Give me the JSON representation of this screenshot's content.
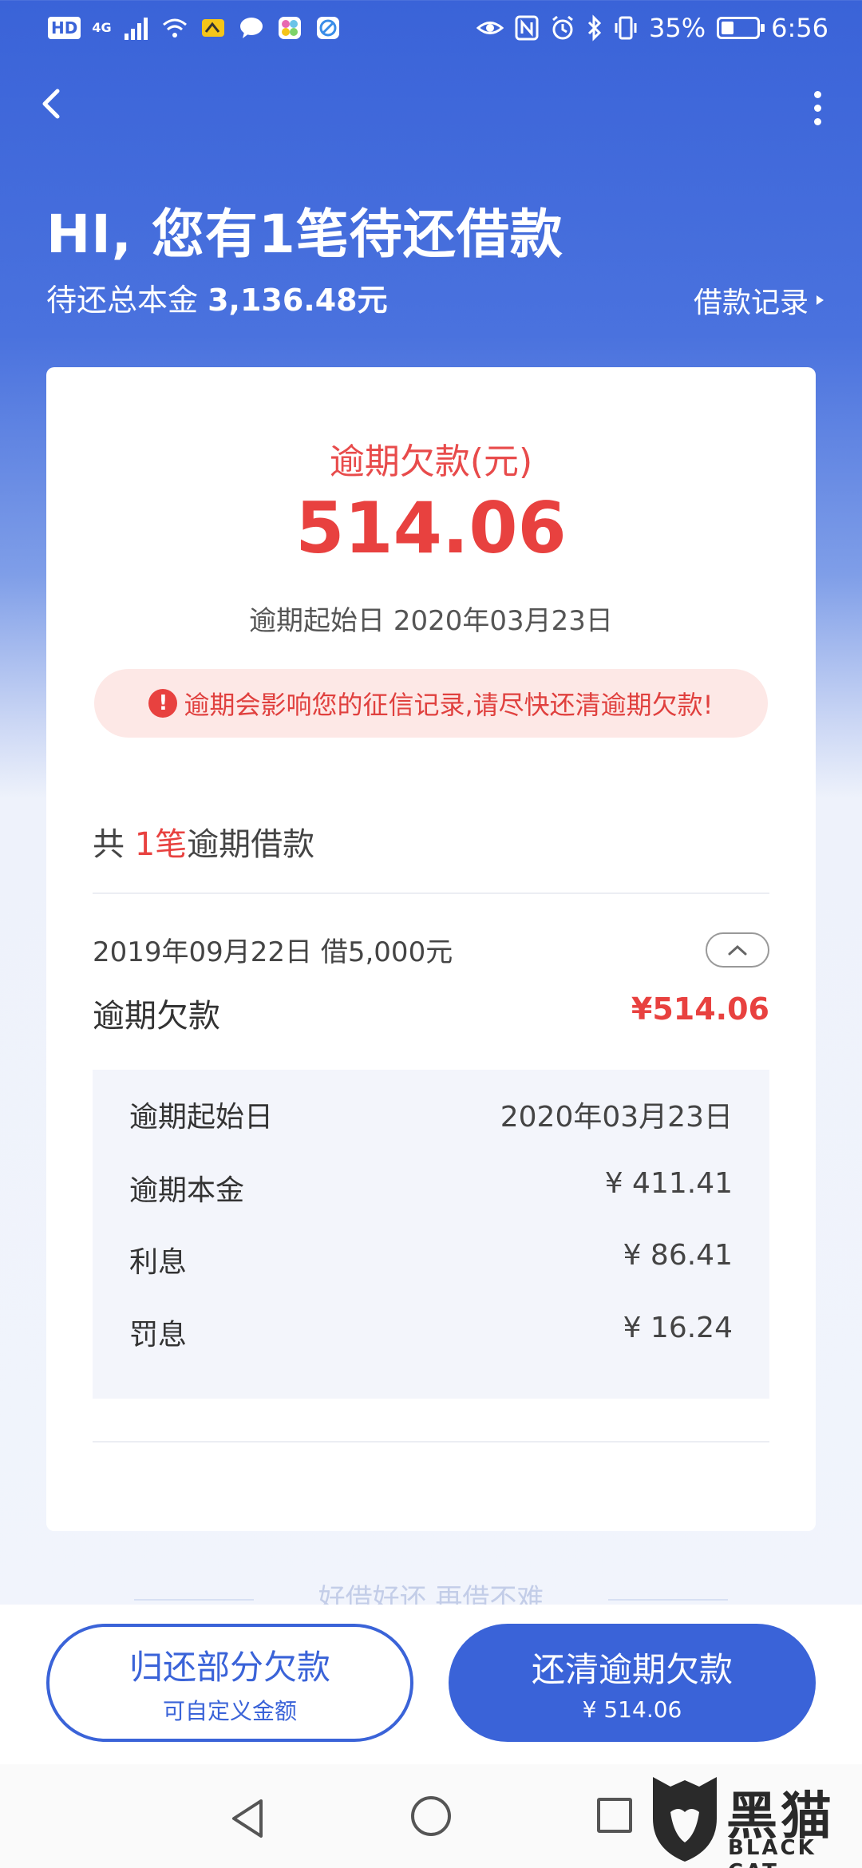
{
  "status_bar": {
    "hd": "HD",
    "network": "4G",
    "battery_percent": "35%",
    "battery_level": 0.35,
    "time": "6:56",
    "icons_left": [
      "signal-icon",
      "wifi-icon",
      "app-notification-icon",
      "message-icon",
      "app-icon",
      "browser-icon"
    ],
    "icons_right": [
      "eye-icon",
      "nfc-icon",
      "alarm-icon",
      "bluetooth-icon",
      "vibrate-icon",
      "battery-icon"
    ]
  },
  "header": {
    "greeting": "HI, 您有1笔待还借款",
    "principal_label": "待还总本金",
    "principal_amount": "3,136.48元",
    "records_link": "借款记录"
  },
  "summary": {
    "overdue_label": "逾期欠款(元)",
    "overdue_amount": "514.06",
    "overdue_start_label": "逾期起始日",
    "overdue_start_date": "2020年03月23日",
    "warning": "逾期会影响您的征信记录,请尽快还清逾期欠款!"
  },
  "loans": {
    "count_prefix": "共",
    "count_value": "1笔",
    "count_suffix": "逾期借款",
    "items": [
      {
        "date_and_amount": "2019年09月22日 借5,000元",
        "overdue_label": "逾期欠款",
        "overdue_amount": "¥514.06",
        "details": [
          {
            "label": "逾期起始日",
            "value": "2020年03月23日"
          },
          {
            "label": "逾期本金",
            "value": "¥ 411.41"
          },
          {
            "label": "利息",
            "value": "¥ 86.41"
          },
          {
            "label": "罚息",
            "value": "¥ 16.24"
          }
        ]
      }
    ]
  },
  "slogan": "好借好还 再借不难",
  "actions": {
    "partial_main": "归还部分欠款",
    "partial_sub": "可自定义金额",
    "full_main": "还清逾期欠款",
    "full_sub": "¥ 514.06"
  },
  "watermark": {
    "cn": "黑猫",
    "en": "BLACK CAT"
  },
  "colors": {
    "brand_blue": "#3a63d8",
    "alert_red": "#e8413f",
    "warning_bg": "#fde8e6"
  }
}
